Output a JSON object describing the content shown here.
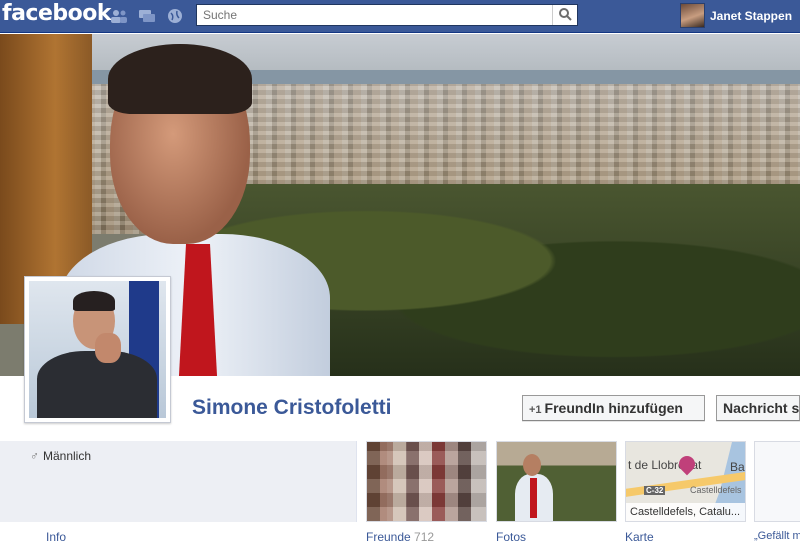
{
  "topbar": {
    "logo": "facebook",
    "search_placeholder": "Suche",
    "user_name": "Janet Stappen"
  },
  "profile": {
    "name": "Simone Cristofoletti",
    "add_friend_label": "FreundIn hinzufügen",
    "add_friend_icon": "+1",
    "message_label": "Nachricht s"
  },
  "about": {
    "gender_symbol": "♂",
    "gender": "Männlich"
  },
  "map": {
    "place1": "t de Llobregat",
    "place2": "Bar",
    "road": "C-32",
    "place3": "Castelldefels",
    "caption": "Castelldefels, Catalu..."
  },
  "tabs": {
    "info": "Info",
    "friends": "Freunde",
    "friends_count": "712",
    "photos": "Fotos",
    "map": "Karte",
    "likes": "„Gefällt mi"
  },
  "colors": {
    "brand": "#3b5998",
    "tie": "#c0161d"
  }
}
